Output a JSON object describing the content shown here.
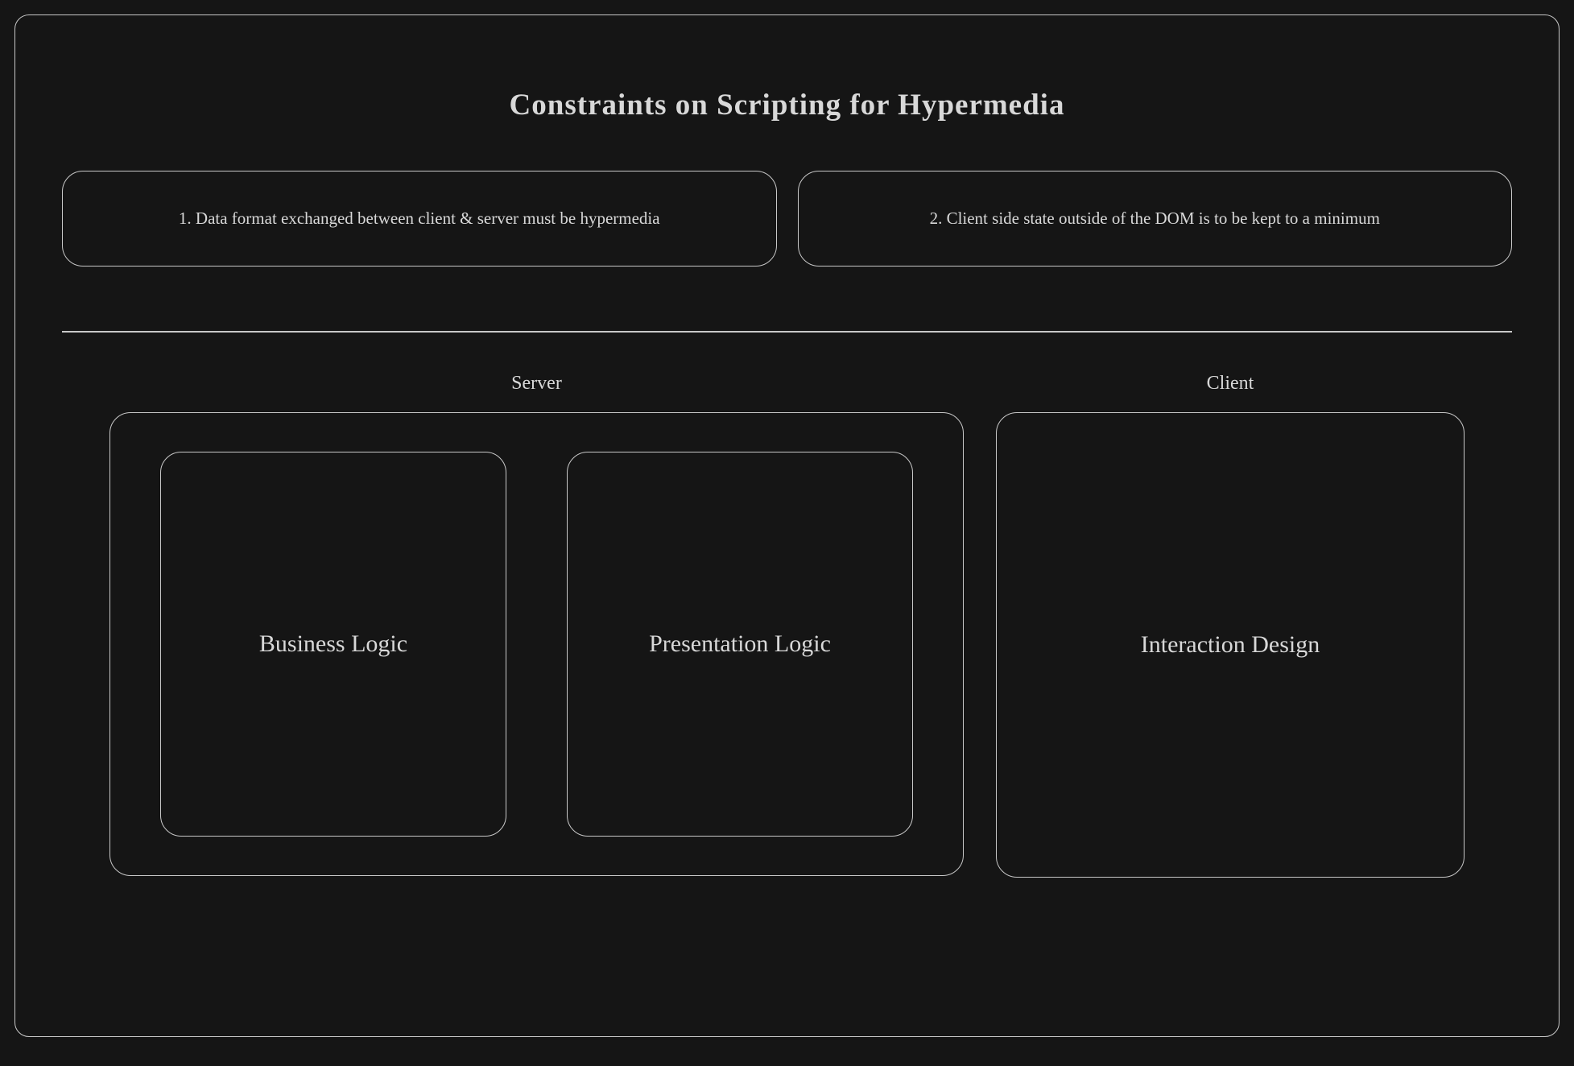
{
  "title": "Constraints on Scripting for Hypermedia",
  "constraints": [
    "1. Data format exchanged between client & server must be hypermedia",
    "2. Client side state outside of the DOM is to be kept to a minimum"
  ],
  "tiers": {
    "server": {
      "label": "Server",
      "modules": [
        "Business Logic",
        "Presentation Logic"
      ]
    },
    "client": {
      "label": "Client",
      "modules": [
        "Interaction Design"
      ]
    }
  }
}
